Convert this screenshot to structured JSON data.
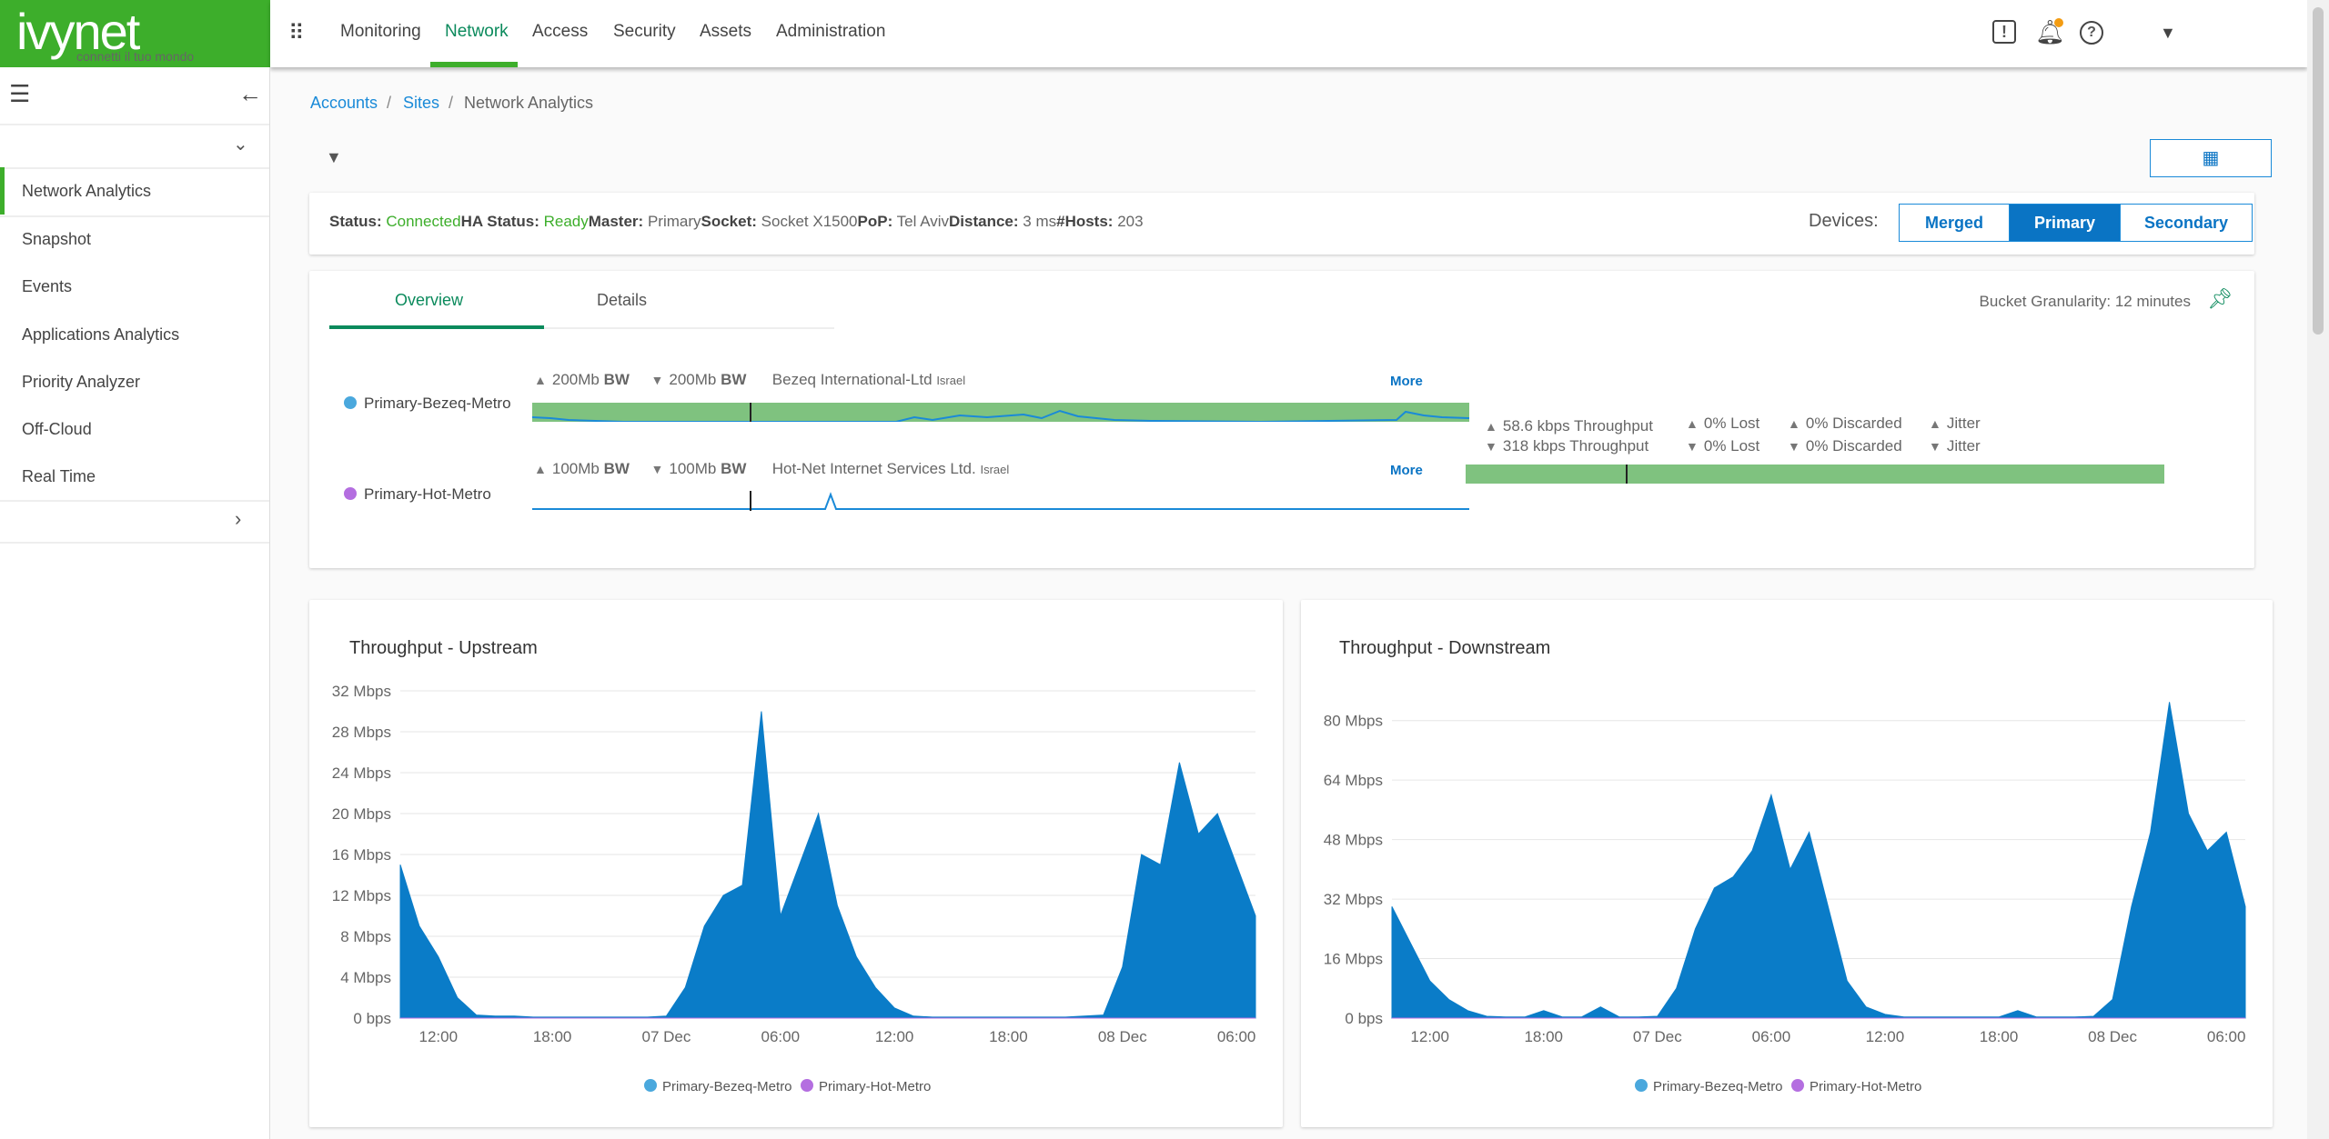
{
  "brand": {
    "name": "ivynet",
    "tagline": "connetti il tuo mondo",
    "color": "#3dae2b"
  },
  "nav": {
    "items": [
      "Monitoring",
      "Network",
      "Access",
      "Security",
      "Assets",
      "Administration"
    ],
    "active": "Network",
    "icons": [
      "apps-grid-icon",
      "alert-icon",
      "bell-icon",
      "help-icon",
      "caret-down-icon"
    ]
  },
  "sidebar": {
    "items": [
      "Network Analytics",
      "Snapshot",
      "Events",
      "Applications Analytics",
      "Priority Analyzer",
      "Off-Cloud",
      "Real Time"
    ],
    "active": "Network Analytics"
  },
  "breadcrumb": [
    "Accounts",
    "Sites",
    "Network Analytics"
  ],
  "status": {
    "status_label": "Status:",
    "status": "Connected",
    "ha_label": "HA Status:",
    "ha": "Ready",
    "master_label": "Master:",
    "master": "Primary",
    "socket_label": "Socket:",
    "socket": "Socket X1500",
    "pop_label": "PoP:",
    "pop": "Tel Aviv",
    "distance_label": "Distance:",
    "distance": "3 ms",
    "hosts_label": "#Hosts:",
    "hosts": "203"
  },
  "devices": {
    "label": "Devices:",
    "options": [
      "Merged",
      "Primary",
      "Secondary"
    ],
    "selected": "Primary"
  },
  "tabs": {
    "items": [
      "Overview",
      "Details"
    ],
    "active": "Overview",
    "granularity": "Bucket Granularity: 12 minutes"
  },
  "links": [
    {
      "name": "Primary-Bezeq-Metro",
      "color": "#4aa8dd",
      "up_bw": "200Mb",
      "down_bw": "200Mb",
      "bw": "BW",
      "isp": "Bezeq International-Ltd",
      "country": "Israel",
      "more": "More"
    },
    {
      "name": "Primary-Hot-Metro",
      "color": "#b46ee0",
      "up_bw": "100Mb",
      "down_bw": "100Mb",
      "bw": "BW",
      "isp": "Hot-Net Internet Services Ltd.",
      "country": "Israel",
      "more": "More"
    }
  ],
  "metrics": {
    "up": [
      "58.6 kbps Throughput",
      "0% Lost",
      "0% Discarded",
      "Jitter"
    ],
    "down": [
      "318 kbps Throughput",
      "0% Lost",
      "0% Discarded",
      "Jitter"
    ]
  },
  "chart_data": [
    {
      "type": "area",
      "title": "Throughput - Upstream",
      "yunit": "Mbps",
      "yticks": [
        "0 bps",
        "4 Mbps",
        "8 Mbps",
        "12 Mbps",
        "16 Mbps",
        "20 Mbps",
        "24 Mbps",
        "28 Mbps",
        "32 Mbps"
      ],
      "ylim": [
        0,
        32
      ],
      "xticks": [
        "12:00",
        "18:00",
        "07 Dec",
        "06:00",
        "12:00",
        "18:00",
        "08 Dec",
        "06:00"
      ],
      "grid": true,
      "legend": "bottom",
      "x_start": "06 Dec 10:00",
      "x_step_hours": 1,
      "series": [
        {
          "name": "Primary-Bezeq-Metro",
          "color": "#0a7cc8",
          "values": [
            15,
            9,
            6,
            2,
            0.3,
            0.2,
            0.2,
            0.1,
            0.1,
            0.1,
            0.1,
            0.1,
            0.1,
            0.1,
            0.2,
            3,
            9,
            12,
            13,
            30,
            10,
            15,
            20,
            11,
            6,
            3,
            1,
            0.2,
            0.1,
            0.1,
            0.1,
            0.1,
            0.1,
            0.1,
            0.1,
            0.1,
            0.2,
            0.3,
            5,
            16,
            15,
            25,
            18,
            20,
            15,
            10
          ]
        },
        {
          "name": "Primary-Hot-Metro",
          "color": "#b46ee0",
          "values": [
            0,
            0,
            0,
            0,
            0,
            0,
            0,
            0,
            0,
            0,
            0,
            0,
            0,
            0,
            0,
            0,
            0,
            0,
            0,
            0,
            0,
            0,
            0,
            0,
            0,
            0,
            0,
            0,
            0,
            0,
            0,
            0,
            0,
            0,
            0,
            0,
            0,
            0,
            0,
            0,
            0,
            0,
            0,
            0,
            0,
            0
          ]
        }
      ]
    },
    {
      "type": "area",
      "title": "Throughput - Downstream",
      "yunit": "Mbps",
      "yticks": [
        "0 bps",
        "16 Mbps",
        "32 Mbps",
        "48 Mbps",
        "64 Mbps",
        "80 Mbps"
      ],
      "ylim": [
        0,
        88
      ],
      "xticks": [
        "12:00",
        "18:00",
        "07 Dec",
        "06:00",
        "12:00",
        "18:00",
        "08 Dec",
        "06:00"
      ],
      "grid": true,
      "legend": "bottom",
      "x_start": "06 Dec 10:00",
      "x_step_hours": 1,
      "series": [
        {
          "name": "Primary-Bezeq-Metro",
          "color": "#0a7cc8",
          "values": [
            30,
            20,
            10,
            5,
            2,
            0.5,
            0.3,
            0.3,
            2,
            0.3,
            0.3,
            3,
            0.3,
            0.3,
            0.5,
            8,
            24,
            35,
            38,
            45,
            60,
            40,
            50,
            30,
            10,
            3,
            1,
            0.3,
            0.3,
            0.3,
            0.3,
            0.3,
            0.3,
            2,
            0.3,
            0.3,
            0.3,
            0.5,
            5,
            30,
            50,
            85,
            55,
            45,
            50,
            30
          ]
        },
        {
          "name": "Primary-Hot-Metro",
          "color": "#b46ee0",
          "values": [
            0,
            0,
            0,
            0,
            0,
            0,
            0,
            0,
            0,
            0,
            0,
            0,
            0,
            0,
            0,
            0,
            0,
            0,
            0,
            0,
            0,
            0,
            0,
            0,
            0,
            0,
            0,
            0,
            0,
            0,
            0,
            0,
            0,
            0,
            0,
            0,
            0,
            0,
            0,
            0,
            0,
            0,
            0,
            0,
            0,
            0
          ]
        }
      ]
    }
  ]
}
